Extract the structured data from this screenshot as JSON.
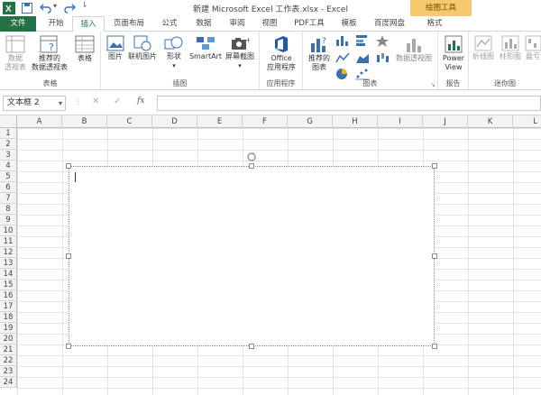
{
  "title": {
    "text": "新建 Microsoft Excel 工作表.xlsx - Excel",
    "context_tab": "绘图工具"
  },
  "tabs": [
    {
      "label": "文件"
    },
    {
      "label": "开始"
    },
    {
      "label": "插入"
    },
    {
      "label": "页面布局"
    },
    {
      "label": "公式"
    },
    {
      "label": "数据"
    },
    {
      "label": "审阅"
    },
    {
      "label": "视图"
    },
    {
      "label": "PDF工具"
    },
    {
      "label": "模板"
    },
    {
      "label": "百度网盘"
    },
    {
      "label": "格式"
    }
  ],
  "ribbon": {
    "groups": {
      "tables": "表格",
      "illustrations": "插图",
      "apps": "应用程序",
      "charts": "图表",
      "reports": "报告",
      "sparklines": "迷你图"
    },
    "buttons": {
      "pivot_table": "数据\n透视表",
      "recommended_pivot": "推荐的\n数据透视表",
      "table": "表格",
      "pictures": "图片",
      "online_pictures": "联机图片",
      "shapes": "形状",
      "smartart": "SmartArt",
      "screenshot": "屏幕截图",
      "office_apps": "Office\n应用程序",
      "recommended_charts": "推荐的\n图表",
      "pivot_chart": "数据透视图",
      "power_view": "Power\nView",
      "line_spark": "折线图",
      "column_spark": "柱形图",
      "winloss_spark": "盈亏"
    }
  },
  "formula_bar": {
    "name_box": "文本框 2",
    "fx": "fx"
  },
  "columns": [
    "A",
    "B",
    "C",
    "D",
    "E",
    "F",
    "G",
    "H",
    "I",
    "J",
    "K",
    "L"
  ],
  "rows": [
    "1",
    "2",
    "3",
    "4",
    "5",
    "6",
    "7",
    "8",
    "9",
    "10",
    "11",
    "12",
    "13",
    "14",
    "15",
    "16",
    "17",
    "18",
    "19",
    "20",
    "21",
    "22",
    "23",
    "24"
  ],
  "colors": {
    "excel_green": "#217346",
    "context_tab": "#f7c96f"
  }
}
